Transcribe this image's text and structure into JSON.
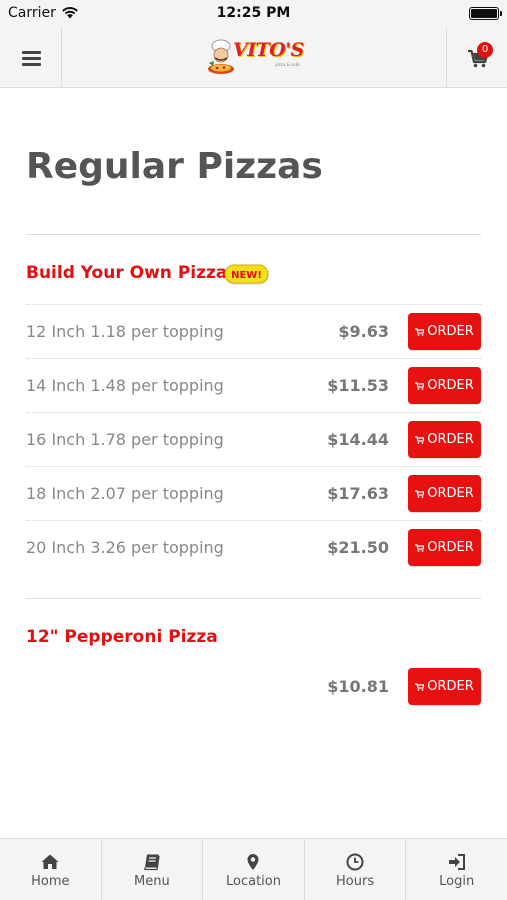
{
  "status_bar": {
    "carrier": "Carrier",
    "time": "12:25 PM"
  },
  "header": {
    "logo_text": "VITO'S",
    "logo_subtext": "pizza & subs",
    "cart_count": "0",
    "menu_icon": "hamburger-icon",
    "cart_icon": "cart-icon"
  },
  "page": {
    "title": "Regular Pizzas"
  },
  "items": [
    {
      "title": "Build Your Own Pizza",
      "badge": "NEW!",
      "options": [
        {
          "label": "12 Inch 1.18 per topping",
          "price": "$9.63",
          "button": "ORDER"
        },
        {
          "label": "14 Inch 1.48 per topping",
          "price": "$11.53",
          "button": "ORDER"
        },
        {
          "label": "16 Inch 1.78 per topping",
          "price": "$14.44",
          "button": "ORDER"
        },
        {
          "label": "18 Inch 2.07 per topping",
          "price": "$17.63",
          "button": "ORDER"
        },
        {
          "label": "20 Inch 3.26 per topping",
          "price": "$21.50",
          "button": "ORDER"
        }
      ]
    },
    {
      "title": "12\" Pepperoni Pizza",
      "options": [
        {
          "label": "",
          "price": "$10.81",
          "button": "ORDER"
        }
      ]
    }
  ],
  "tabs": [
    {
      "label": "Home",
      "icon": "home-icon"
    },
    {
      "label": "Menu",
      "icon": "book-icon"
    },
    {
      "label": "Location",
      "icon": "map-pin-icon"
    },
    {
      "label": "Hours",
      "icon": "clock-icon"
    },
    {
      "label": "Login",
      "icon": "sign-in-icon"
    }
  ],
  "colors": {
    "accent": "#e81111",
    "title_red": "#e21010",
    "header_bg": "#f4f4f4"
  }
}
